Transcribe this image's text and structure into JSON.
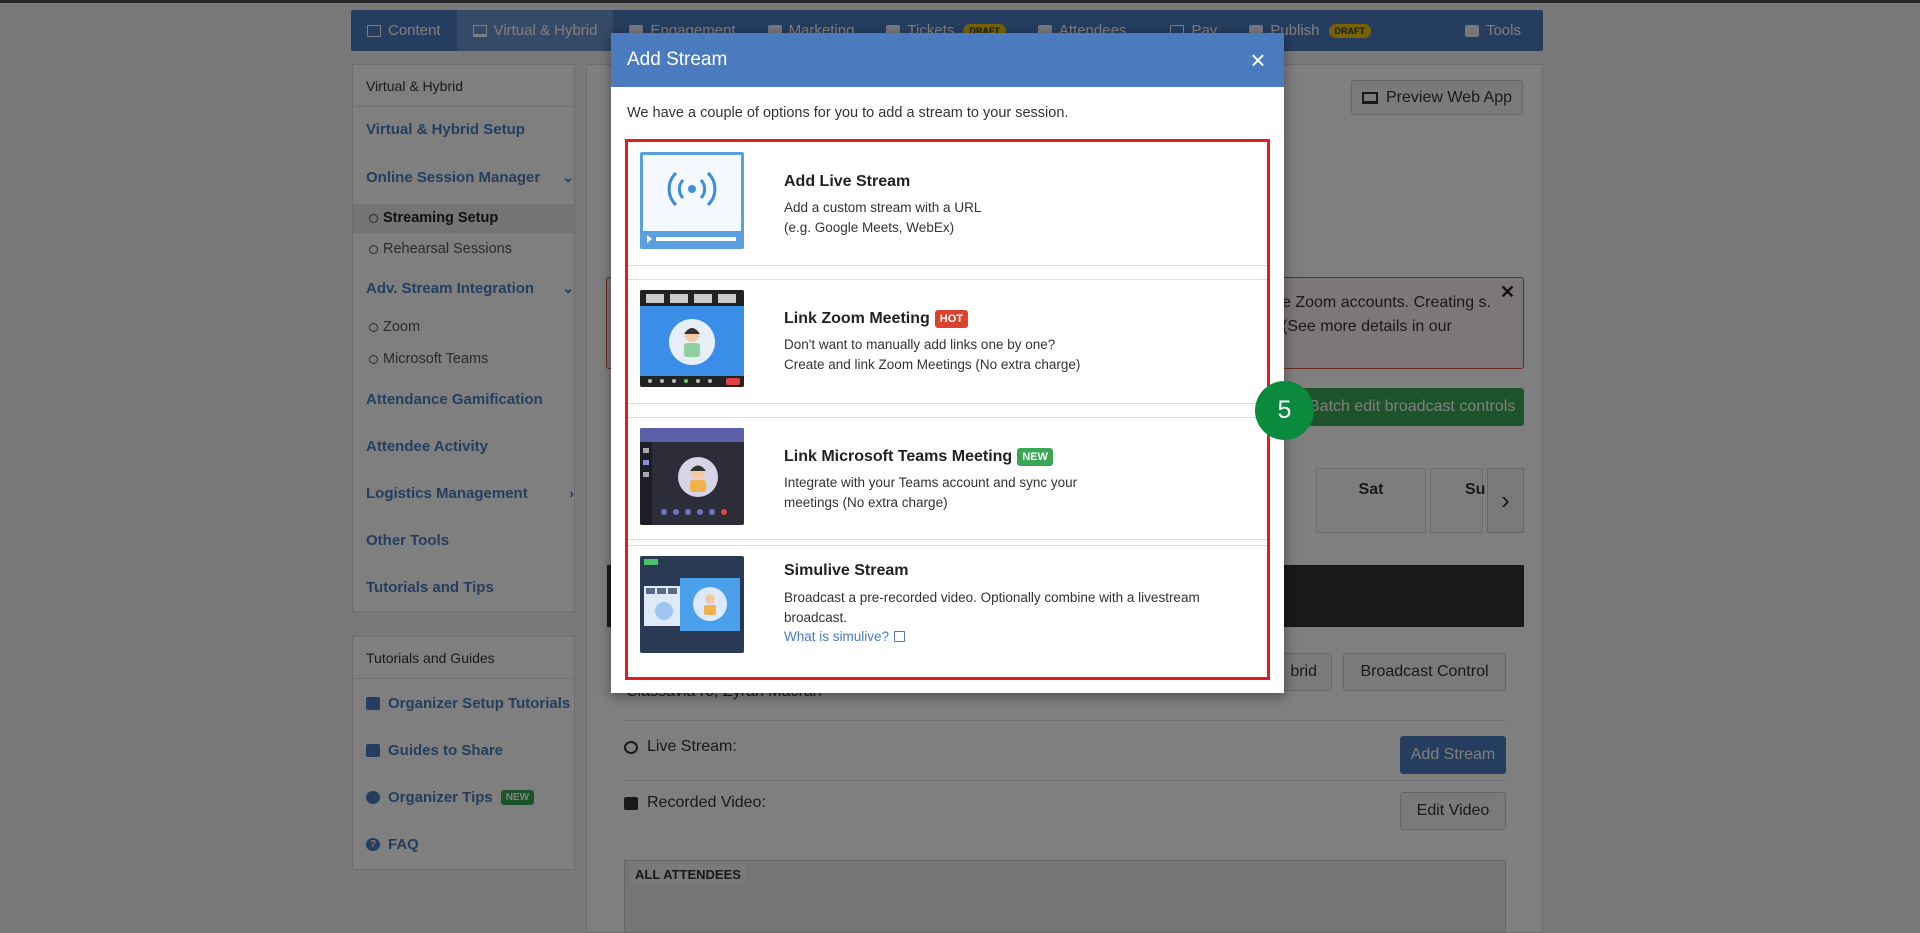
{
  "nav": {
    "tabs": [
      {
        "label": "Content"
      },
      {
        "label": "Virtual & Hybrid"
      },
      {
        "label": "Engagement"
      },
      {
        "label": "Marketing"
      },
      {
        "label": "Tickets",
        "badge": "DRAFT"
      },
      {
        "label": "Attendees"
      },
      {
        "label": "Pay"
      },
      {
        "label": "Publish",
        "badge": "DRAFT"
      },
      {
        "label": "Tools"
      }
    ]
  },
  "sidebar": {
    "heading": "Virtual & Hybrid",
    "items": [
      {
        "label": "Virtual & Hybrid Setup"
      },
      {
        "label": "Online Session Manager"
      },
      {
        "label": "Streaming Setup"
      },
      {
        "label": "Rehearsal Sessions"
      },
      {
        "label": "Adv. Stream Integration"
      },
      {
        "label": "Zoom"
      },
      {
        "label": "Microsoft Teams"
      },
      {
        "label": "Attendance Gamification"
      },
      {
        "label": "Attendee Activity"
      },
      {
        "label": "Logistics Management"
      },
      {
        "label": "Other Tools"
      },
      {
        "label": "Tutorials and Tips"
      }
    ],
    "guides_heading": "Tutorials and Guides",
    "guides": [
      {
        "label": "Organizer Setup Tutorials"
      },
      {
        "label": "Guides to Share"
      },
      {
        "label": "Organizer Tips",
        "badge": "NEW"
      },
      {
        "label": "FAQ"
      }
    ]
  },
  "main": {
    "preview_button": "Preview Web App",
    "alert_text": "e Zoom accounts. Creating s. (See more details in our",
    "batch_button": "Batch edit broadcast controls",
    "days": [
      "Sat",
      "Su"
    ],
    "hybrid_button": "brid",
    "broadcast_button": "Broadcast Control",
    "hidden_row_text": "Classavia ro, Zyran Macran",
    "live_stream_label": "Live Stream:",
    "add_stream_button": "Add Stream",
    "recorded_video_label": "Recorded Video:",
    "edit_video_button": "Edit Video",
    "all_attendees": "ALL ATTENDEES"
  },
  "modal": {
    "title": "Add Stream",
    "close": "×",
    "intro": "We have a couple of options for you to add a stream to your session.",
    "options": [
      {
        "title": "Add Live Stream",
        "desc1": "Add a custom stream with a URL",
        "desc2": "(e.g. Google Meets, WebEx)",
        "icon": "live-stream-icon"
      },
      {
        "title": "Link Zoom Meeting",
        "badge": "HOT",
        "desc1": "Don't want to manually add links one by one?",
        "desc2": "Create and link Zoom Meetings (No extra charge)",
        "icon": "zoom-meeting-icon"
      },
      {
        "title": "Link Microsoft Teams Meeting",
        "badge": "NEW",
        "desc1": "Integrate with your Teams account and sync your",
        "desc2": "meetings (No extra charge)",
        "icon": "teams-meeting-icon"
      },
      {
        "title": "Simulive Stream",
        "desc1": "Broadcast a pre-recorded video. Optionally combine with a livestream",
        "desc2": "broadcast.",
        "link": "What is simulive?",
        "icon": "simulive-icon"
      }
    ]
  },
  "step_marker": "5",
  "colors": {
    "brand_blue": "#4a7bbf",
    "success_green": "#3aa757",
    "highlight_red": "#e02020",
    "marker_green": "#0b8a3e",
    "hot_red": "#d9442f"
  }
}
